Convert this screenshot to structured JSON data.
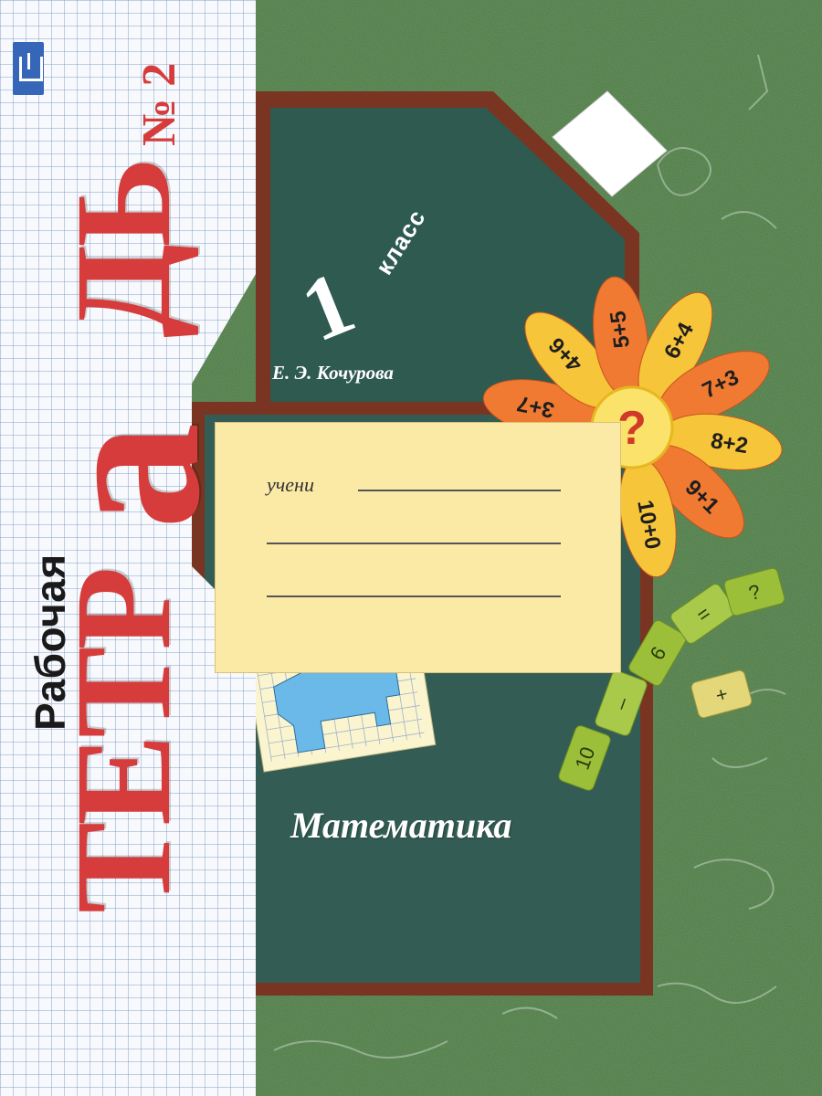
{
  "cover": {
    "label": "Рабочая",
    "title_part_1": "ТЕТР",
    "title_part_a": "а",
    "title_part_2": "ДЬ",
    "volume": "№ 2",
    "grade_number": "1",
    "grade_word": "класс",
    "author": "Е. Э. Кочурова",
    "owner_label": "учени",
    "subject": "Математика"
  },
  "flower": {
    "center": "?",
    "petals": [
      "3+7",
      "4+6",
      "5+5",
      "6+4",
      "7+3",
      "8+2",
      "9+1",
      "10+0"
    ]
  },
  "puzzle": {
    "pieces": [
      "10",
      "–",
      "6",
      "=",
      "?",
      "+"
    ]
  },
  "colors": {
    "title_red": "#d63c3c",
    "chalkboard": "#2f5a50",
    "frame_brown": "#7a3422",
    "petal_orange": "#f07a32",
    "petal_yellow": "#f6c53a",
    "card_yellow": "#fbe9a6",
    "grid_blue": "#7896c8",
    "shape_blue": "#6ab9e9"
  }
}
